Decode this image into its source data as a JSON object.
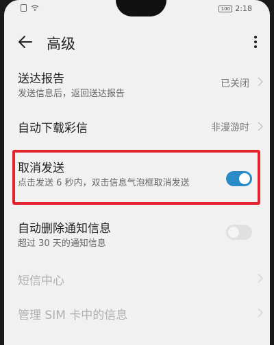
{
  "status_bar": {
    "battery": "100",
    "time": "2:18"
  },
  "header": {
    "title": "高级"
  },
  "settings": {
    "delivery_report": {
      "label": "送达报告",
      "sub": "发送信息后，返回送达报告",
      "value": "已关闭"
    },
    "auto_download_mms": {
      "label": "自动下载彩信",
      "value": "非漫游时"
    },
    "cancel_send": {
      "label": "取消发送",
      "sub": "点击发送 6 秒内，双击信息气泡框取消发送",
      "enabled": true
    },
    "auto_delete_notifications": {
      "label": "自动删除通知信息",
      "sub": "超过 30 天的通知信息",
      "enabled": false
    },
    "sms_center": {
      "label": "短信中心"
    },
    "manage_sim": {
      "label": "管理 SIM 卡中的信息"
    }
  },
  "colors": {
    "accent": "#2a8cc7",
    "highlight_border": "#e1242e"
  }
}
